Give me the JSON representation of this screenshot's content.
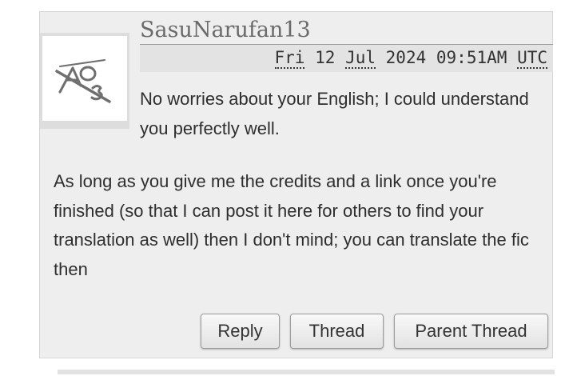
{
  "comment": {
    "username": "SasuNarufan13",
    "date": {
      "weekday": "Fri",
      "day": "12",
      "month": "Jul",
      "year": "2024",
      "time": "09:51AM",
      "tz": "UTC"
    },
    "paragraphs": [
      "No worries about your English; I could understand you perfectly well.",
      "As long as you give me the credits and a link once you're finished (so that I can post it here for others to find your translation as well) then I don't mind; you can translate the fic then"
    ],
    "actions": {
      "reply": "Reply",
      "thread": "Thread",
      "parent_thread": "Parent Thread"
    }
  },
  "icons": {
    "avatar": "default-avatar-icon"
  },
  "colors": {
    "panel_bg": "#eeeeee",
    "header_bg": "#e3e3e3",
    "username": "#6a6a6a",
    "text": "#2e2e2e"
  }
}
